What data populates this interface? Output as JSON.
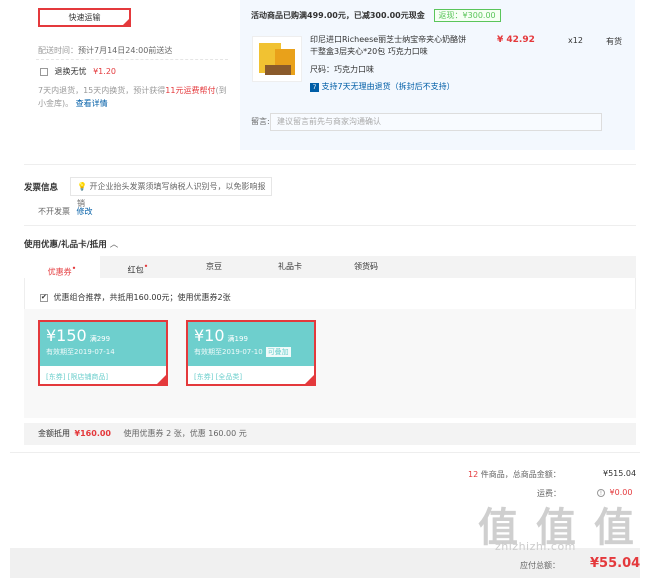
{
  "shipping": {
    "method_label": "快速运输",
    "delivery_time_label": "配送时间：",
    "delivery_time_value": "预计7月14日24:00前送达",
    "return_free_label": "退换无忧",
    "return_free_price": "¥1.20",
    "return_desc_prefix": "7天内退货，15天内换货，预计获得",
    "return_desc_highlight": "11元运费帮付",
    "return_desc_suffix": "(到小金库)。",
    "view_details": "查看详情"
  },
  "order_item": {
    "promo_text": "活动商品已购满499.00元，已减300.00元现金",
    "promo_tag": "返现：¥300.00",
    "product_name": "印尼进口Richeese丽芝士纳宝帝夹心奶酪饼干整盒3层夹心*20包 巧克力口味",
    "price": "¥ 42.92",
    "quantity": "x12",
    "stock_status": "有货",
    "size_label": "尺码：巧克力口味",
    "return_policy": "支持7天无理由退货（拆封后不支持）",
    "note_label": "留言:",
    "note_placeholder": "建议留言前先与商家沟通确认"
  },
  "invoice": {
    "title": "发票信息",
    "tip": "开企业抬头发票须填写纳税人识别号，以免影响报销",
    "status": "不开发票",
    "edit": "修改"
  },
  "coupons": {
    "title": "使用优惠/礼品卡/抵用",
    "tabs": [
      "优惠券",
      "红包",
      "京豆",
      "礼品卡",
      "领货码"
    ],
    "combo_text": "优惠组合推荐，共抵用160.00元；使用优惠券2张",
    "items": [
      {
        "amount": "¥150",
        "condition": "满299",
        "expiry": "有效期至2019-07-14",
        "tags": "[东券] [限店铺商品]"
      },
      {
        "amount": "¥10",
        "condition": "满199",
        "expiry": "有效期至2019-07-10",
        "stack": "可叠加",
        "tags": "[东券] [全品类]"
      }
    ],
    "summary_label": "金额抵用",
    "summary_amount": "¥160.00",
    "summary_desc": "使用优惠券 2 张，优惠 160.00 元"
  },
  "totals": {
    "count": "12",
    "count_text": "件商品，总商品金额：",
    "total_amount": "¥515.04",
    "shipping_label": "运费：",
    "shipping_amount": "¥0.00",
    "bottom_label": "应付总额：",
    "bottom_amount": "¥55.04"
  },
  "watermark": {
    "big": "值 值 值",
    "url": "zhizhizhi.com"
  }
}
